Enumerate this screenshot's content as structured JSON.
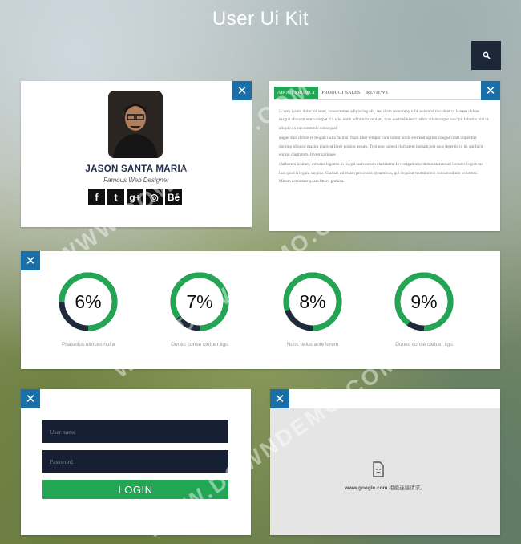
{
  "header": {
    "title": "User Ui Kit",
    "search_icon": "search-icon"
  },
  "profile": {
    "name": "JASON SANTA MARIA",
    "role": "Famous Web Designer",
    "social": [
      {
        "name": "facebook-icon",
        "glyph": "f"
      },
      {
        "name": "twitter-icon",
        "glyph": "t"
      },
      {
        "name": "google-plus-icon",
        "glyph": "g+"
      },
      {
        "name": "instagram-icon",
        "glyph": "◎"
      },
      {
        "name": "behance-icon",
        "glyph": "Bē"
      }
    ],
    "close_glyph": "✕"
  },
  "tabs": {
    "items": [
      "ABOUT PROJECT",
      "PRODUCT SALES",
      "REVIEWS"
    ],
    "active": 0,
    "paragraphs": [
      "Lorem ipsum dolor sit amet, consectetuer adipiscing elit, sed diam nonummy nibh euismod tincidunt ut laoreet dolore magna aliquam erat volutpat. Ut wisi enim ad minim veniam, quis nostrud exerci tation ullamcorper suscipit lobortis nisl ut aliquip ex ea commodo consequat.",
      "augue duis dolore te feugait nulla facilisi. Nam liber tempor cum soluta nobis eleifend option congue nihil imperdiet doming id quod mazim placerat facer possim assum. Typi non habent claritatem insitam; est usus legentis in iis qui facit eorum claritatem. Investigationes",
      "claritatem insitam; est usus legentis in iis qui facit eorum claritatem. Investigationes demonstraverunt lectores legere me lius quod ii legunt saepius. Claritas est etiam processus dynamicus, qui sequitur mutationem consuetudium lectorum. Mirum est notare quam littera gothica."
    ]
  },
  "stats": [
    {
      "value": "6%",
      "percent": 75,
      "label": "Phasellus ultrices nulla"
    },
    {
      "value": "7%",
      "percent": 85,
      "label": "Donec conse ctetuer ligu"
    },
    {
      "value": "8%",
      "percent": 80,
      "label": "Nunc tellus ante lorem"
    },
    {
      "value": "9%",
      "percent": 90,
      "label": "Donec conse ctetuer ligu"
    }
  ],
  "colors": {
    "accent": "#22a654",
    "dark": "#1f2a3a",
    "close": "#1a6fa8"
  },
  "login": {
    "username_placeholder": "User name",
    "password_placeholder": "Password",
    "button": "LOGIN"
  },
  "map": {
    "domain": "www.google.com",
    "message": "拒绝连接请求。"
  },
  "watermark": "WWW.DOWNDEMO.COM"
}
